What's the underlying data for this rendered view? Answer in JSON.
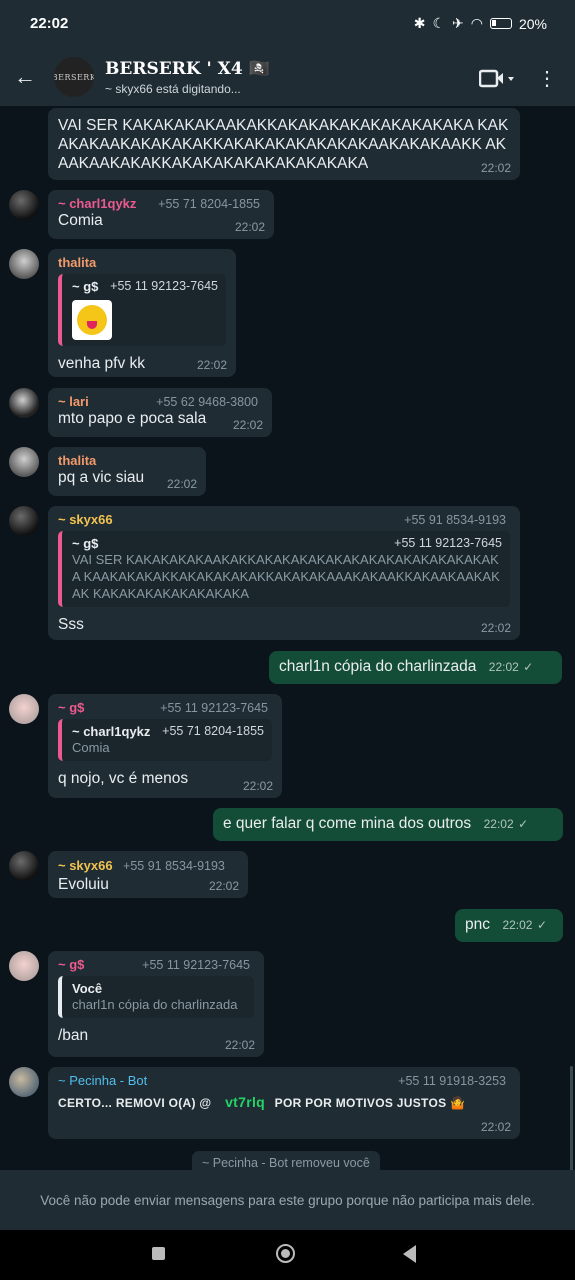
{
  "status_bar": {
    "time": "22:02",
    "battery": "20%"
  },
  "header": {
    "avatar_text": "BERSERK",
    "title": "BERSERK ' X4 🏴‍☠️",
    "subtitle": "~ skyx66 está digitando..."
  },
  "messages": {
    "m1": {
      "text": "VAI SER KAKAKAKAKAAKAKKAKAKAKAKAKAKAKAKAKA KAKAKAKAAKAKAKAKAKKAKAKAKAKAKAKAKAAKAKAKAAKK AKAAKAAKAKAKKAKAKAKAKAKAKAKAKAKA",
      "time": "22:02"
    },
    "m2": {
      "sender": "~ charl1qykz",
      "phone": "+55 71 8204-1855",
      "text": "Comia",
      "time": "22:02"
    },
    "m3": {
      "sender": "thalita",
      "quote_name": "~ g$",
      "quote_phone": "+55 11 92123-7645",
      "text": "venha pfv kk",
      "time": "22:02"
    },
    "m4": {
      "sender": "~ lari",
      "phone": "+55 62 9468-3800",
      "text": "mto papo e poca sala",
      "time": "22:02"
    },
    "m5": {
      "sender": "thalita",
      "text": "pq a vic siau",
      "time": "22:02"
    },
    "m6": {
      "sender": "~ skyx66",
      "phone": "+55 91 8534-9193",
      "quote_name": "~ g$",
      "quote_phone": "+55 11 92123-7645",
      "quote_text": "VAI SER KAKAKAKAKAAKAKKAKAKAKAKAKAKAKAKAKAKAKAKAKAKA KAAKAKAKAKKAKAKAKAKAKKAKAKAKAAAKAKAAKKAKAAKAAKAKAK KAKAKAKAKAKAKAKAKA",
      "text": "Sss",
      "time": "22:02"
    },
    "o1": {
      "text": "charl1n cópia do charlinzada",
      "time": "22:02"
    },
    "m7": {
      "sender": "~ g$",
      "phone": "+55 11 92123-7645",
      "quote_name": "~ charl1qykz",
      "quote_phone": "+55 71 8204-1855",
      "quote_text": "Comia",
      "text": "q nojo, vc é menos",
      "time": "22:02"
    },
    "o2": {
      "text": "e quer falar q come mina dos outros",
      "time": "22:02"
    },
    "m8": {
      "sender": "~ skyx66",
      "phone": "+55 91 8534-9193",
      "text": "Evoluiu",
      "time": "22:02"
    },
    "o3": {
      "text": "pnc",
      "time": "22:02"
    },
    "m9": {
      "sender": "~ g$",
      "phone": "+55 11 92123-7645",
      "quote_name": "Você",
      "quote_text": "charl1n cópia do charlinzada",
      "text": "/ban",
      "time": "22:02"
    },
    "m10": {
      "sender": "~ Pecinha - Bot",
      "phone": "+55 11 91918-3253",
      "text_pre": "CERTO... REMOVI O(A) @",
      "mention": "vt7rlq",
      "text_post": "POR POR MOTIVOS JUSTOS 🤷",
      "time": "22:02"
    }
  },
  "system_message": "~ Pecinha - Bot removeu você",
  "footer": "Você não pode enviar mensagens para este grupo porque não participa mais dele."
}
